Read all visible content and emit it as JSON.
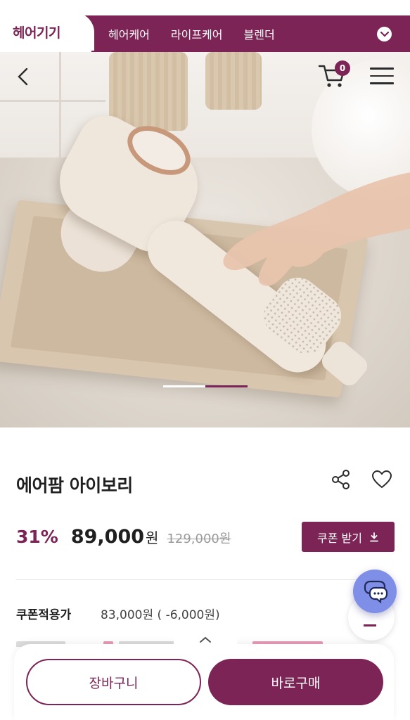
{
  "colors": {
    "brand": "#7c2455",
    "chat_fab": "#7f8ee6",
    "strikethrough": "#9a9a9a"
  },
  "category_bar": {
    "active_tab": "헤어기기",
    "tabs": [
      "헤어케어",
      "라이프케어",
      "블렌더"
    ],
    "dropdown_icon": "chevron-down-icon"
  },
  "header": {
    "back_icon": "chevron-left-icon",
    "cart_icon": "cart-icon",
    "cart_count": "0",
    "menu_icon": "hamburger-menu-icon"
  },
  "gallery": {
    "slide_count": 2,
    "active_slide": 2,
    "image_subject": "hair-dryer-product-photo"
  },
  "product": {
    "name": "에어팜 아이보리",
    "discount": "31%",
    "price": "89,000",
    "price_unit": "원",
    "original_price": "129,000원",
    "coupon_button": "쿠폰 받기",
    "coupon_price_label": "쿠폰적용가",
    "coupon_price_value": "83,000원 ( -6,000원)"
  },
  "floating": {
    "chat_icon": "chat-bubbles-icon",
    "scroll_top_icon": "scroll-top-icon"
  },
  "bottom_bar": {
    "expand_icon": "chevron-up-icon",
    "cart_button": "장바구니",
    "buy_button": "바로구매"
  }
}
